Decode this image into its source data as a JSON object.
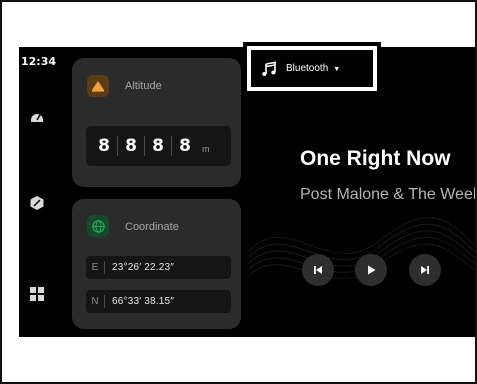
{
  "status": {
    "time": "12:34"
  },
  "nav": {
    "items": [
      {
        "icon": "speedometer-icon"
      },
      {
        "icon": "hexagon-icon"
      },
      {
        "icon": "grid-apps-icon"
      }
    ]
  },
  "altitude": {
    "title": "Altitude",
    "icon": "warning-triangle-icon",
    "digits": [
      "8",
      "8",
      "8",
      "8"
    ],
    "unit": "m"
  },
  "coordinate": {
    "title": "Coordinate",
    "icon": "globe-icon",
    "rows": [
      {
        "dir": "E",
        "value": "23°26′ 22.23″"
      },
      {
        "dir": "N",
        "value": "66°33′ 38.15″"
      }
    ]
  },
  "media": {
    "source": "Bluetooth",
    "source_icon": "music-note-icon",
    "title": "One Right Now",
    "artist": "Post Malone & The Weeknd",
    "controls": [
      "previous-icon",
      "play-icon",
      "next-icon"
    ]
  },
  "colors": {
    "screen_bg": "#000000",
    "card_bg": "#2b2b2b",
    "altitude_accent": "#f2a23c",
    "coordinate_accent": "#1fa85c",
    "highlight_border": "#000000"
  }
}
